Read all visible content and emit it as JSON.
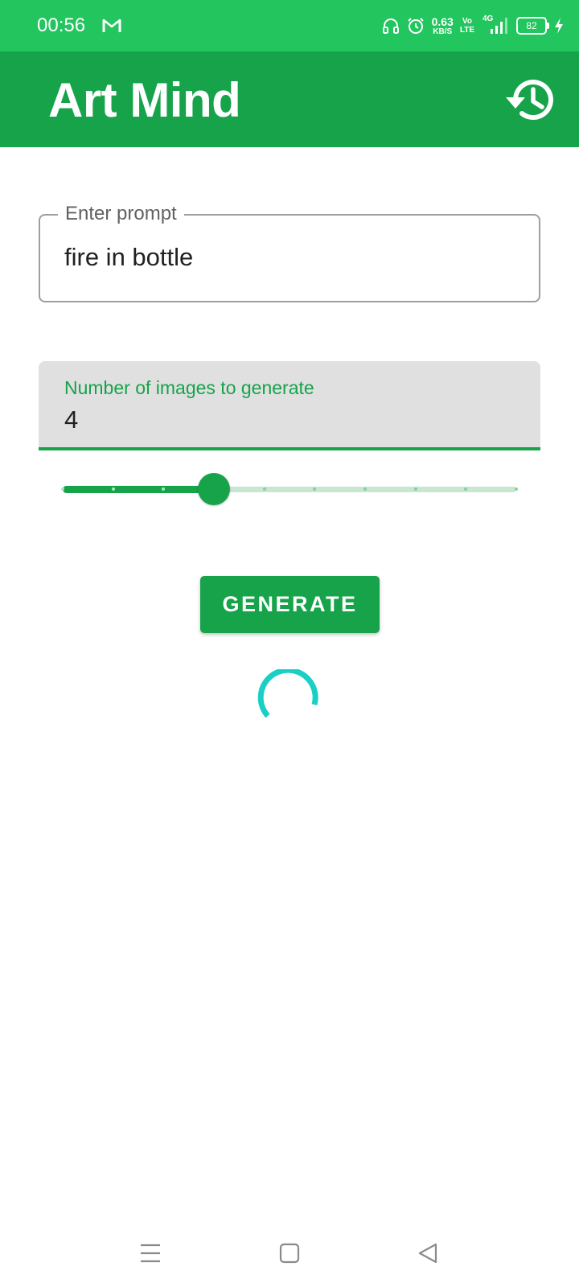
{
  "status_bar": {
    "time": "00:56",
    "net_speed_value": "0.63",
    "net_speed_unit": "KB/S",
    "volte_top": "Vo",
    "volte_bottom": "LTE",
    "network_type": "4G",
    "battery_level": "82",
    "icons": [
      "gmail-icon",
      "headphones-icon",
      "alarm-icon",
      "signal-icon",
      "battery-icon",
      "charging-icon"
    ]
  },
  "app_bar": {
    "title": "Art Mind",
    "history_icon": "history-icon"
  },
  "prompt_field": {
    "label": "Enter prompt",
    "value": "fire in bottle"
  },
  "count_field": {
    "label": "Number of images to generate",
    "value": "4"
  },
  "slider": {
    "min": 1,
    "max": 10,
    "value": 4
  },
  "generate_button": {
    "label": "GENERATE"
  },
  "spinner": {
    "color": "#1ad0c6"
  },
  "nav_bar": {
    "icons": [
      "menu-icon",
      "home-icon",
      "back-icon"
    ]
  },
  "colors": {
    "status_bar": "#22c55e",
    "app_bar": "#16a34a",
    "accent": "#16a34a"
  }
}
